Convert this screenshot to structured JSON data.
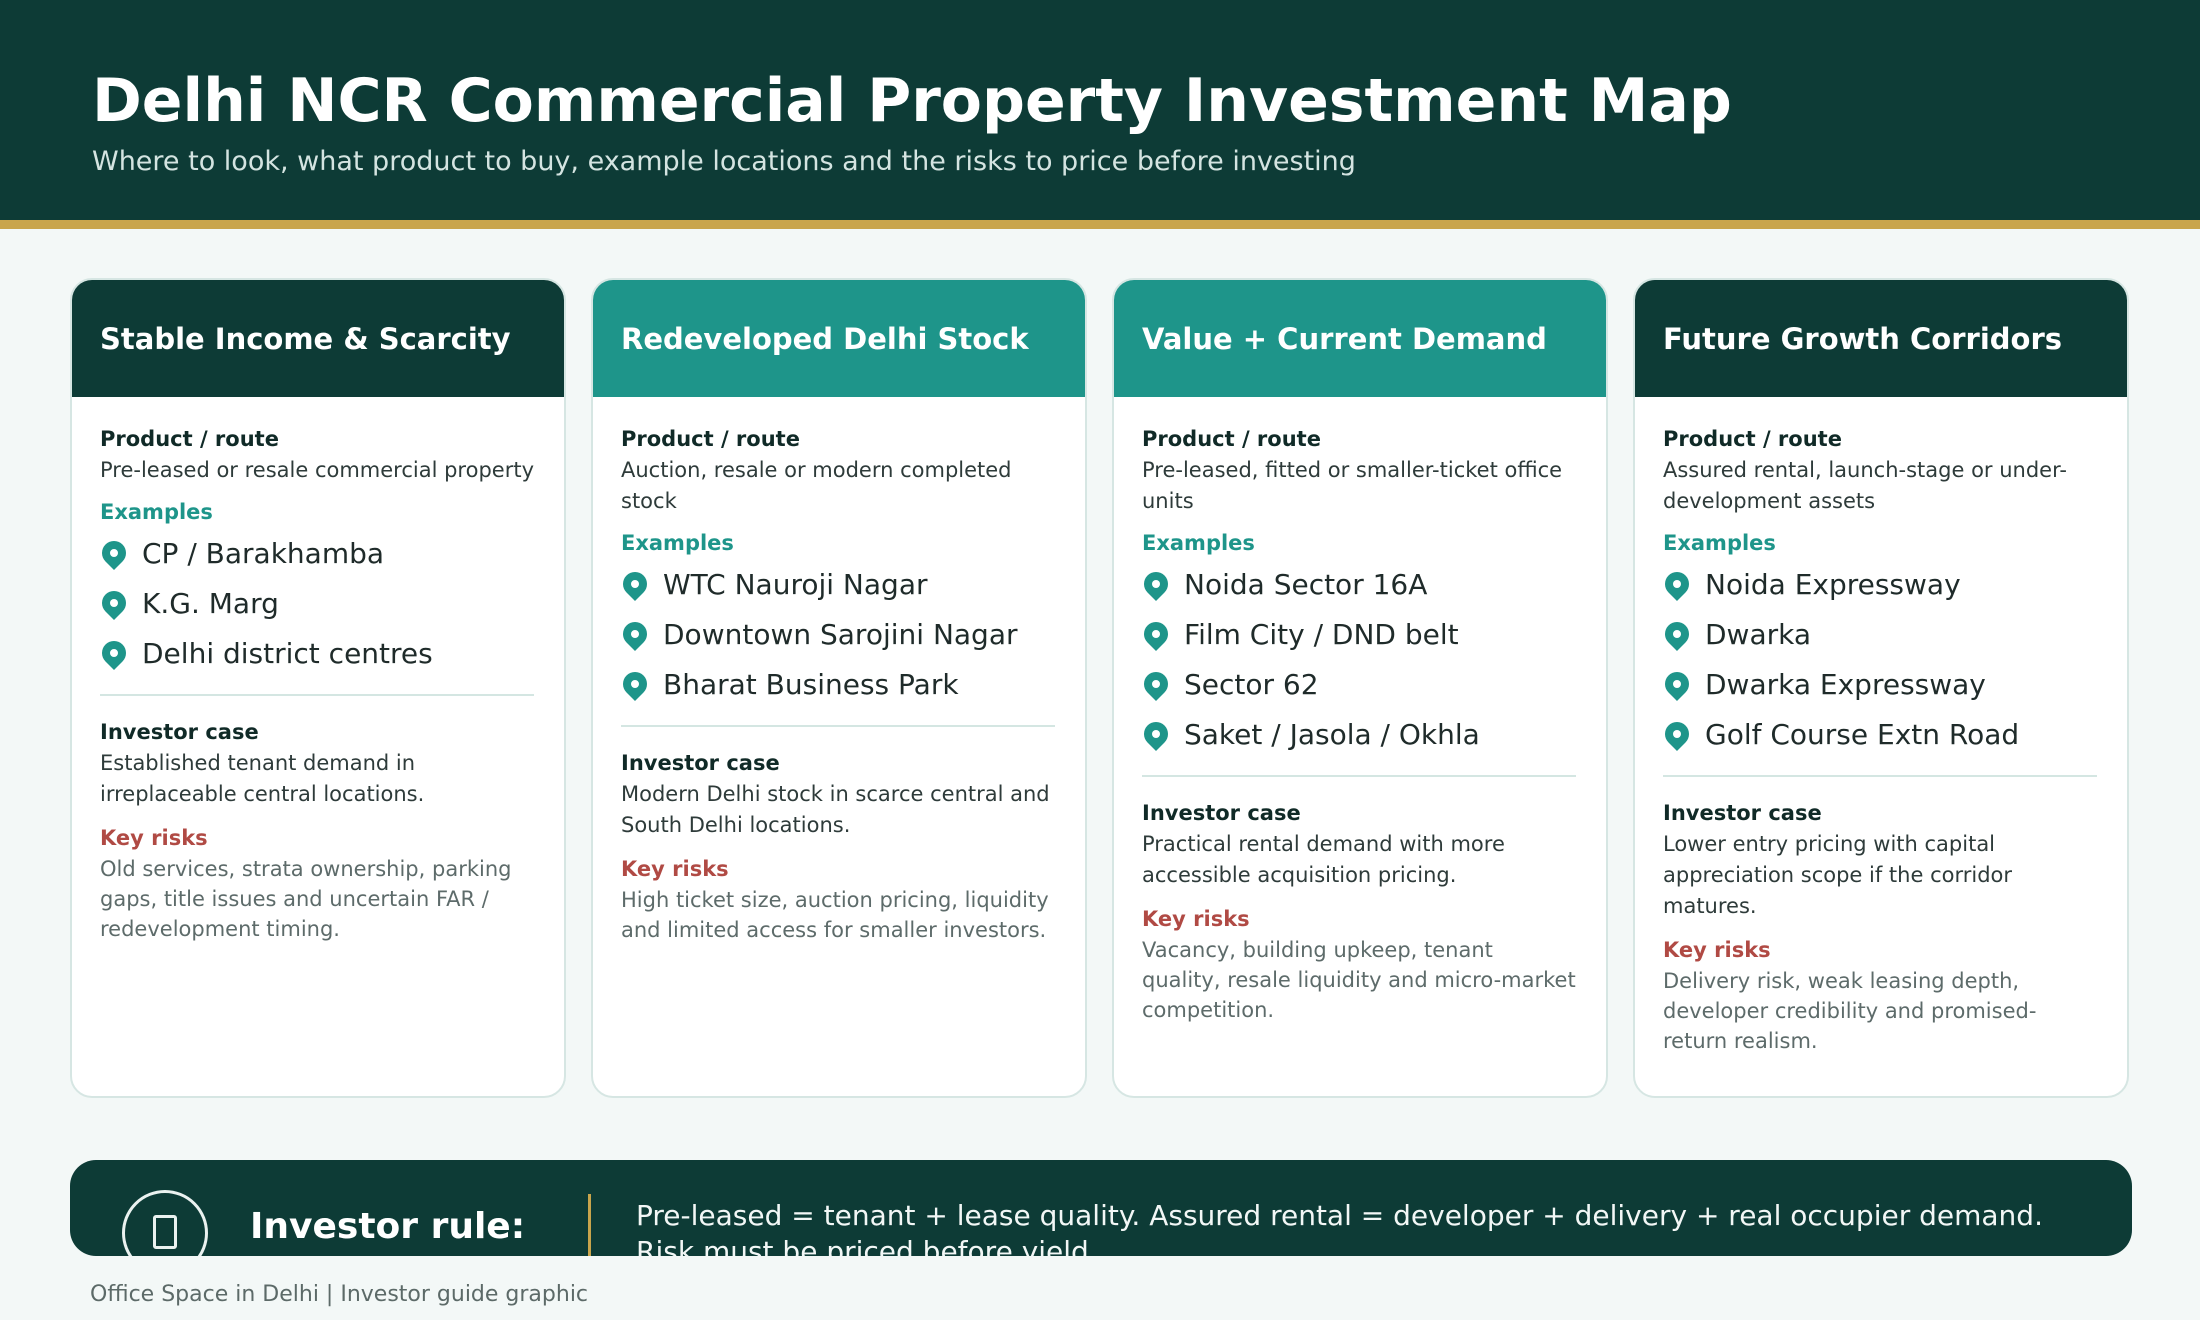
{
  "header": {
    "title": "Delhi NCR Commercial Property Investment Map",
    "subtitle": "Where to look, what product to buy, example locations and the risks to price before investing"
  },
  "cards": [
    {
      "title": "Stable Income & Scarcity",
      "product_label": "Product / route",
      "product": "Pre-leased or resale commercial property",
      "examples_label": "Examples",
      "examples": [
        "CP / Barakhamba",
        "K.G. Marg",
        "Delhi district centres"
      ],
      "case_label": "Investor case",
      "case": "Established tenant demand in irreplaceable central locations.",
      "risks_label": "Key risks",
      "risks": "Old services, strata ownership, parking gaps, title issues and uncertain FAR / redevelopment timing."
    },
    {
      "title": "Redeveloped Delhi Stock",
      "product_label": "Product / route",
      "product": "Auction, resale or modern completed stock",
      "examples_label": "Examples",
      "examples": [
        "WTC Nauroji Nagar",
        "Downtown Sarojini Nagar",
        "Bharat Business Park"
      ],
      "case_label": "Investor case",
      "case": "Modern Delhi stock in scarce central and South Delhi locations.",
      "risks_label": "Key risks",
      "risks": "High ticket size, auction pricing, liquidity and limited access for smaller investors."
    },
    {
      "title": "Value + Current Demand",
      "product_label": "Product / route",
      "product": "Pre-leased, fitted or smaller-ticket office units",
      "examples_label": "Examples",
      "examples": [
        "Noida Sector 16A",
        "Film City / DND belt",
        "Sector 62",
        "Saket / Jasola / Okhla"
      ],
      "case_label": "Investor case",
      "case": "Practical rental demand with more accessible acquisition pricing.",
      "risks_label": "Key risks",
      "risks": "Vacancy, building upkeep, tenant quality, resale liquidity and micro-market competition."
    },
    {
      "title": "Future Growth Corridors",
      "product_label": "Product / route",
      "product": "Assured rental, launch-stage or under-development assets",
      "examples_label": "Examples",
      "examples": [
        "Noida Expressway",
        "Dwarka",
        "Dwarka Expressway",
        "Golf Course Extn Road"
      ],
      "case_label": "Investor case",
      "case": "Lower entry pricing with capital appreciation scope if the corridor matures.",
      "risks_label": "Key risks",
      "risks": "Delivery risk, weak leasing depth, developer credibility and promised-return realism."
    }
  ],
  "rule": {
    "icon": "building-icon",
    "label": "Investor rule:",
    "text": "Pre-leased = tenant + lease quality. Assured rental = developer + delivery + real occupier demand. Risk must be priced before yield."
  },
  "footer": {
    "credit": "Office Space in Delhi | Investor guide graphic"
  },
  "colors": {
    "dark_green": "#0d3b36",
    "teal": "#1e958a",
    "gold": "#c9a54c",
    "risk_red": "#b04a44"
  }
}
